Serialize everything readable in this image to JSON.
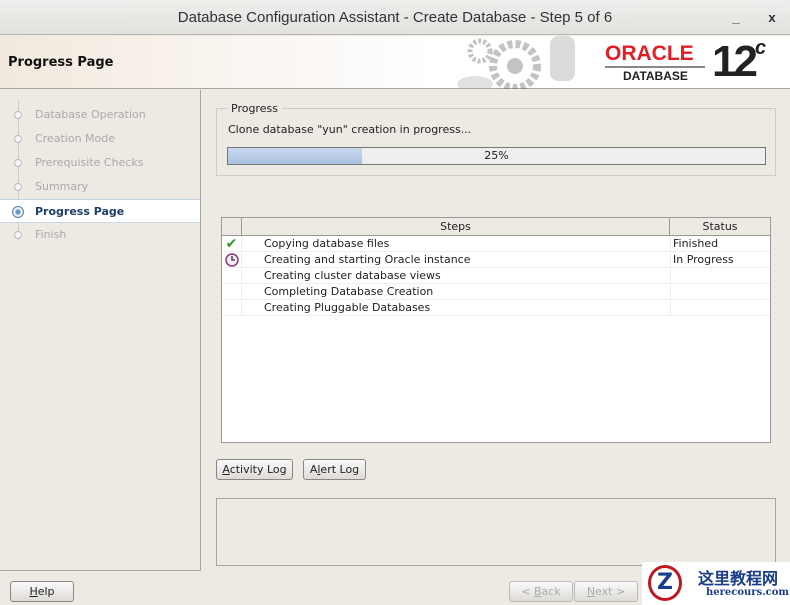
{
  "window": {
    "title": "Database Configuration Assistant - Create Database - Step 5 of 6",
    "minimize": "_",
    "maximize": "□",
    "close": "x"
  },
  "header": {
    "page_title": "Progress Page",
    "brand": "ORACLE",
    "brand_sub": "DATABASE",
    "version": "12",
    "version_sup": "c"
  },
  "sidebar": {
    "items": [
      {
        "label": "Database Operation"
      },
      {
        "label": "Creation Mode"
      },
      {
        "label": "Prerequisite Checks"
      },
      {
        "label": "Summary"
      },
      {
        "label": "Progress Page",
        "active": true
      },
      {
        "label": "Finish"
      }
    ]
  },
  "progress": {
    "legend": "Progress",
    "status": "Clone database \"yun\" creation in progress...",
    "percent": 25,
    "percent_label": "25%"
  },
  "steps_table": {
    "headers": [
      "Steps",
      "Status"
    ],
    "rows": [
      {
        "icon": "check-icon",
        "step": "Copying database files",
        "status": "Finished"
      },
      {
        "icon": "clock-icon",
        "step": "Creating and starting Oracle instance",
        "status": "In Progress"
      },
      {
        "icon": "",
        "step": "Creating cluster database views",
        "status": ""
      },
      {
        "icon": "",
        "step": "Completing Database Creation",
        "status": ""
      },
      {
        "icon": "",
        "step": "Creating Pluggable Databases",
        "status": ""
      }
    ]
  },
  "buttons": {
    "activity_log_u": "A",
    "activity_log": "ctivity Log",
    "alert_log_pre": "A",
    "alert_log_u": "l",
    "alert_log": "ert Log",
    "help_u": "H",
    "help": "elp",
    "back_pre": "< ",
    "back_u": "B",
    "back": "ack",
    "next_u": "N",
    "next": "ext >"
  },
  "watermark": {
    "cn": "这里教程网",
    "en": "herecours.com",
    "z": "Z"
  },
  "colors": {
    "accent": "#1d3d6b",
    "oracle_red": "#e31f26"
  }
}
